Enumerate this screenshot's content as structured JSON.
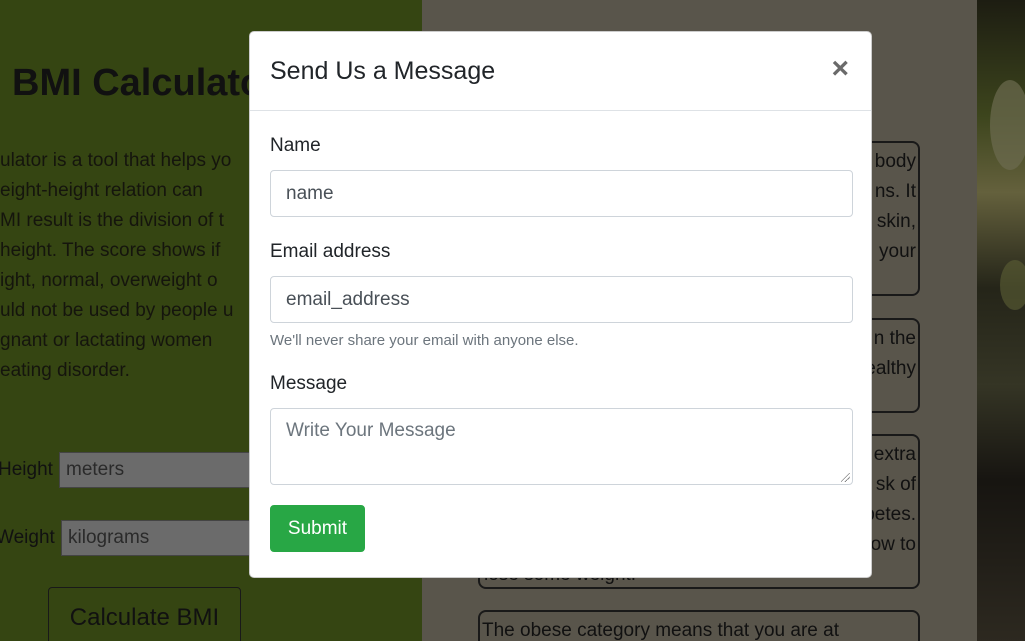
{
  "background": {
    "bmi_title": "BMI Calculato",
    "bmi_description_lines": [
      "ulator is a tool that helps yo",
      "eight-height  relation  can",
      "MI result is the division of t",
      " height. The score shows if",
      "ight,  normal,  overweight  o",
      "uld not be used by people u",
      "gnant  or  lactating  women",
      "eating disorder."
    ],
    "height_label": "Height",
    "height_placeholder": "meters",
    "weight_label": "Weight",
    "weight_placeholder": "kilograms",
    "calculate_button": "Calculate BMI",
    "info_cards": [
      {
        "lines": [
          "body",
          "ns. It",
          "skin,",
          "your"
        ]
      },
      {
        "lines": [
          "n the",
          "ealthy"
        ]
      },
      {
        "lines": [
          "extra",
          "sk of",
          "betes.",
          "ow to",
          "lose some weight."
        ]
      },
      {
        "lines": [
          "The  obese  category  means  that  you  are  at"
        ]
      }
    ],
    "colors": {
      "left_panel": "#6a8a24",
      "right_panel": "#b3aa96"
    }
  },
  "modal": {
    "title": "Send Us a Message",
    "close_symbol": "×",
    "name_label": "Name",
    "name_placeholder": "name",
    "email_label": "Email address",
    "email_placeholder": "email_address",
    "email_help": "We'll never share your email with anyone else.",
    "message_label": "Message",
    "message_placeholder": "Write Your Message",
    "submit_label": "Submit",
    "colors": {
      "submit": "#28a745"
    }
  }
}
